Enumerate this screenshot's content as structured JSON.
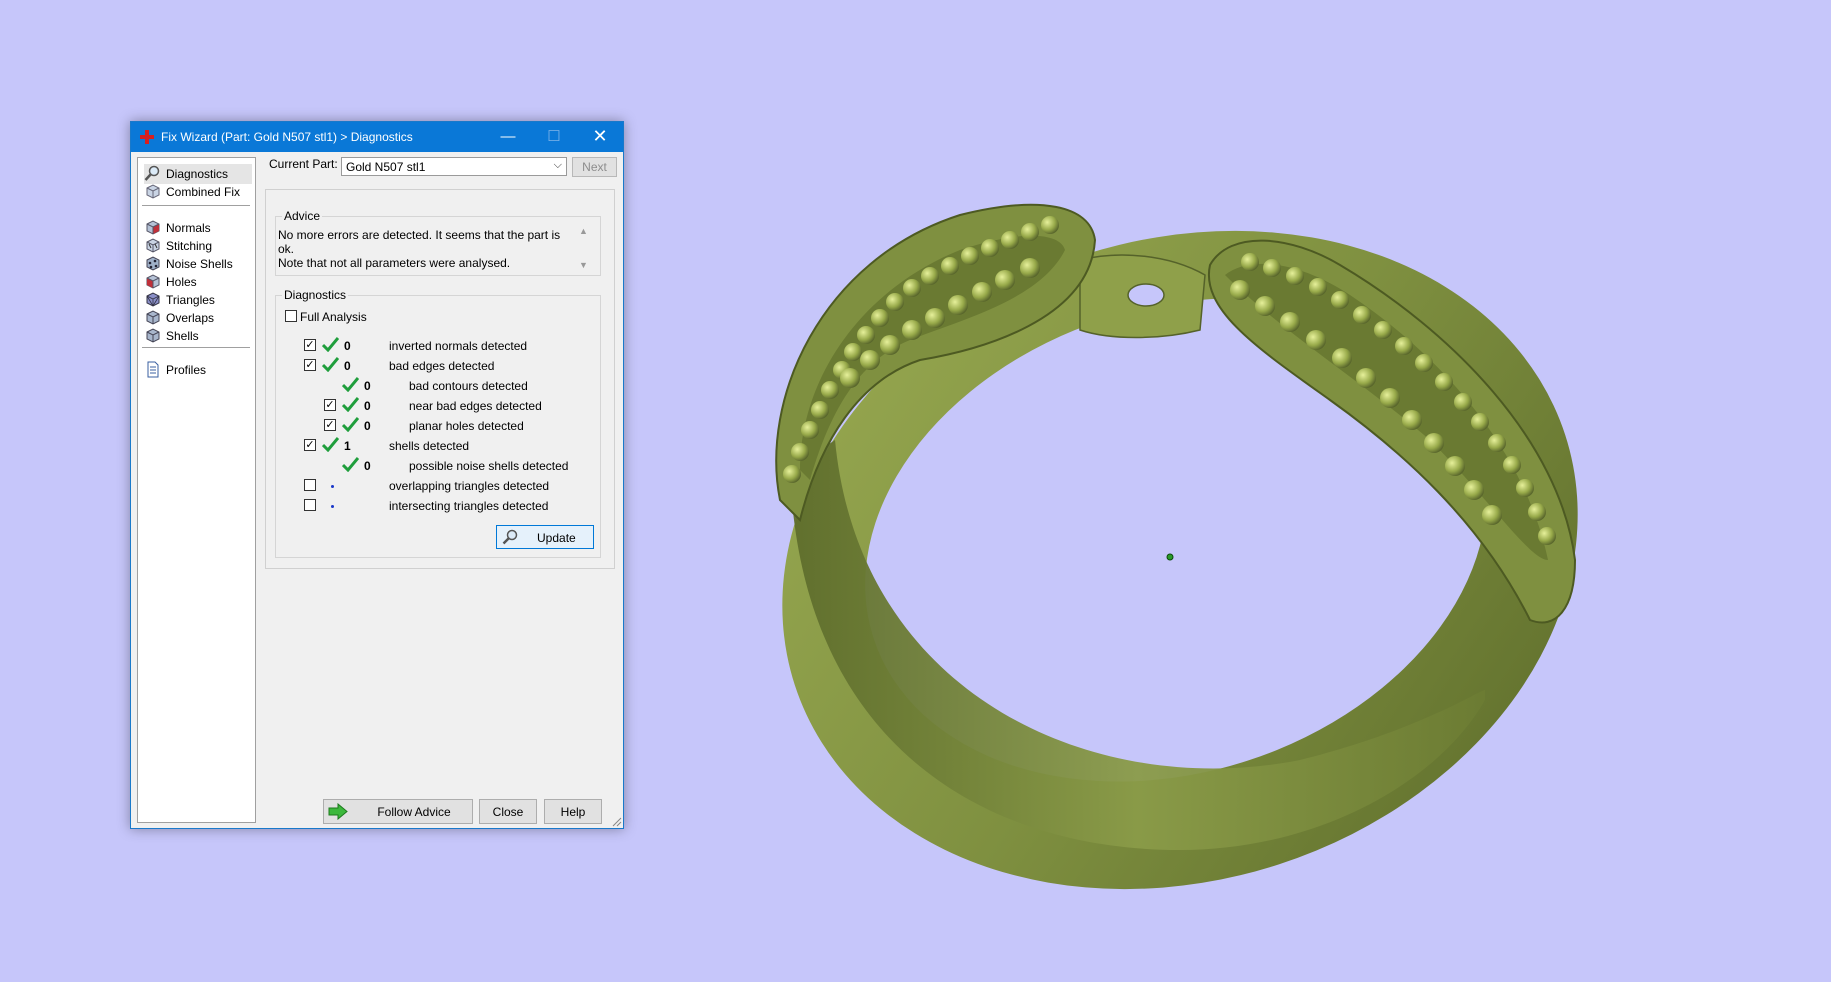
{
  "window": {
    "title": "Fix Wizard (Part: Gold N507 stl1) > Diagnostics",
    "minimize": "—",
    "maximize": "☐",
    "close": "✕"
  },
  "sidebar": {
    "items": [
      {
        "label": "Diagnostics",
        "icon": "magnifier-icon"
      },
      {
        "label": "Combined Fix",
        "icon": "cube-icon"
      },
      {
        "label": "Normals",
        "icon": "normals-cube-icon"
      },
      {
        "label": "Stitching",
        "icon": "stitching-cube-icon"
      },
      {
        "label": "Noise Shells",
        "icon": "noise-shells-cube-icon"
      },
      {
        "label": "Holes",
        "icon": "holes-cube-icon"
      },
      {
        "label": "Triangles",
        "icon": "triangles-cube-icon"
      },
      {
        "label": "Overlaps",
        "icon": "overlaps-cube-icon"
      },
      {
        "label": "Shells",
        "icon": "shells-cube-icon"
      },
      {
        "label": "Profiles",
        "icon": "document-icon"
      }
    ]
  },
  "header": {
    "current_part_label": "Current Part:",
    "current_part_value": "Gold N507 stl1",
    "next_label": "Next"
  },
  "advice": {
    "legend": "Advice",
    "line1": "No more errors are detected. It seems that the part is ok.",
    "line2": "Note that not all parameters were analysed."
  },
  "diagnostics": {
    "legend": "Diagnostics",
    "full_analysis_label": "Full Analysis",
    "rows": [
      {
        "checked": true,
        "status": "ok",
        "count": "0",
        "label": "inverted normals detected"
      },
      {
        "checked": true,
        "status": "ok",
        "count": "0",
        "label": "bad edges detected"
      },
      {
        "checked": null,
        "status": "ok",
        "count": "0",
        "label": "bad contours detected"
      },
      {
        "checked": true,
        "status": "ok",
        "count": "0",
        "label": "near bad edges detected"
      },
      {
        "checked": true,
        "status": "ok",
        "count": "0",
        "label": "planar holes detected"
      },
      {
        "checked": true,
        "status": "ok",
        "count": "1",
        "label": "shells detected"
      },
      {
        "checked": null,
        "status": "ok",
        "count": "0",
        "label": "possible noise shells detected"
      },
      {
        "checked": false,
        "status": "pending",
        "count": "",
        "label": "overlapping triangles detected"
      },
      {
        "checked": false,
        "status": "pending",
        "count": "",
        "label": "intersecting triangles detected"
      }
    ],
    "update_label": "Update"
  },
  "footer": {
    "follow_advice_label": "Follow Advice",
    "close_label": "Close",
    "help_label": "Help"
  },
  "colors": {
    "viewport_bg": "#c6c6fa",
    "model_green": "#8c9c46",
    "title_bar": "#0a78d7",
    "ok_green": "#1f9e3c"
  }
}
